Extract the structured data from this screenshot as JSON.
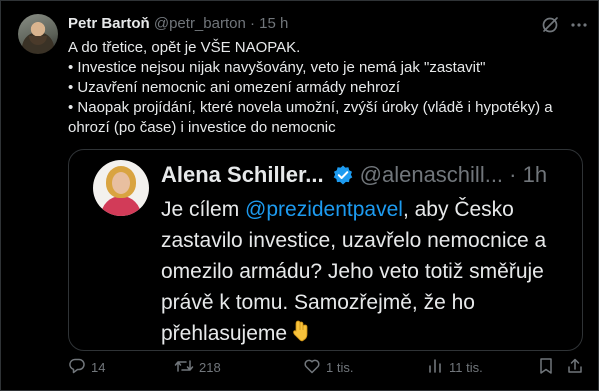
{
  "post": {
    "author_name": "Petr Bartoň",
    "author_handle": "@petr_barton",
    "separator": "·",
    "time": "15 h",
    "lines": [
      "A do třetice, opět je VŠE NAOPAK.",
      "• Investice nejsou nijak navyšovány, veto je nemá jak \"zastavit\"",
      "• Uzavření nemocnic ani omezení armády nehrozí",
      "• Naopak projídání, které novela umožní, zvýší úroky (vládě i hypotéky) a",
      "ohrozí (po čase) i investice do nemocnic"
    ]
  },
  "quote": {
    "author_name": "Alena Schiller...",
    "author_handle": "@alenaschill...",
    "separator": "·",
    "time": "1h",
    "line1_pre": "Je cílem ",
    "mention": "@prezidentpavel",
    "line1_post": ", aby Česko",
    "line2": "zastavilo investice, uzavřelo nemocnice a",
    "line3": "omezilo armádu? Jeho veto totiž směřuje",
    "line4": "právě k tomu. Samozřejmě, že ho",
    "line5": "přehlasujeme"
  },
  "actions": {
    "replies": "14",
    "reposts": "218",
    "likes": "1 tis.",
    "views": "11 tis."
  },
  "icons": {
    "grok": "grok-icon",
    "more": "more-icon",
    "verified": "verified-badge-icon",
    "emoji": "backhand-index-pointing-down-icon",
    "reply": "reply-icon",
    "repost": "repost-icon",
    "like": "heart-icon",
    "views": "views-icon",
    "bookmark": "bookmark-icon",
    "share": "share-icon"
  },
  "colors": {
    "background": "#000000",
    "text": "#e7e9ea",
    "secondary": "#71767b",
    "accent": "#1d9bf0",
    "border": "#2f3336"
  }
}
